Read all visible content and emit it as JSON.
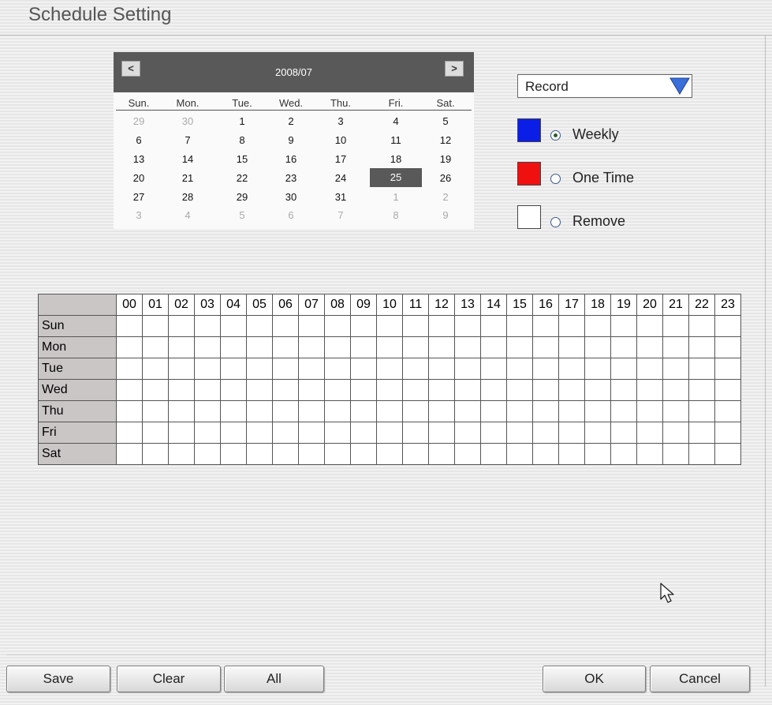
{
  "window": {
    "title": "Schedule Setting"
  },
  "calendar": {
    "month_label": "2008/07",
    "prev_label": "<",
    "next_label": ">",
    "weekdays": [
      "Sun.",
      "Mon.",
      "Tue.",
      "Wed.",
      "Thu.",
      "Fri.",
      "Sat."
    ],
    "weeks": [
      [
        {
          "d": "29",
          "other": true
        },
        {
          "d": "30",
          "other": true
        },
        {
          "d": "1"
        },
        {
          "d": "2"
        },
        {
          "d": "3"
        },
        {
          "d": "4"
        },
        {
          "d": "5"
        }
      ],
      [
        {
          "d": "6"
        },
        {
          "d": "7"
        },
        {
          "d": "8"
        },
        {
          "d": "9"
        },
        {
          "d": "10"
        },
        {
          "d": "11"
        },
        {
          "d": "12"
        }
      ],
      [
        {
          "d": "13"
        },
        {
          "d": "14"
        },
        {
          "d": "15"
        },
        {
          "d": "16"
        },
        {
          "d": "17"
        },
        {
          "d": "18"
        },
        {
          "d": "19"
        }
      ],
      [
        {
          "d": "20"
        },
        {
          "d": "21"
        },
        {
          "d": "22"
        },
        {
          "d": "23"
        },
        {
          "d": "24"
        },
        {
          "d": "25",
          "selected": true
        },
        {
          "d": "26"
        }
      ],
      [
        {
          "d": "27"
        },
        {
          "d": "28"
        },
        {
          "d": "29"
        },
        {
          "d": "30"
        },
        {
          "d": "31"
        },
        {
          "d": "1",
          "other": true
        },
        {
          "d": "2",
          "other": true
        }
      ],
      [
        {
          "d": "3",
          "other": true
        },
        {
          "d": "4",
          "other": true
        },
        {
          "d": "5",
          "other": true
        },
        {
          "d": "6",
          "other": true
        },
        {
          "d": "7",
          "other": true
        },
        {
          "d": "8",
          "other": true
        },
        {
          "d": "9",
          "other": true
        }
      ]
    ]
  },
  "mode_select": {
    "value": "Record",
    "arrow_color": "#3b6fd8"
  },
  "options": [
    {
      "label": "Weekly",
      "color": "#0a1ee8",
      "checked": true
    },
    {
      "label": "One Time",
      "color": "#f01010",
      "checked": false
    },
    {
      "label": "Remove",
      "color": "#ffffff",
      "checked": false
    }
  ],
  "grid": {
    "hours": [
      "00",
      "01",
      "02",
      "03",
      "04",
      "05",
      "06",
      "07",
      "08",
      "09",
      "10",
      "11",
      "12",
      "13",
      "14",
      "15",
      "16",
      "17",
      "18",
      "19",
      "20",
      "21",
      "22",
      "23"
    ],
    "days": [
      "Sun",
      "Mon",
      "Tue",
      "Wed",
      "Thu",
      "Fri",
      "Sat"
    ]
  },
  "buttons": {
    "save": "Save",
    "clear": "Clear",
    "all": "All",
    "ok": "OK",
    "cancel": "Cancel"
  },
  "icons": {
    "cursor": "mouse-pointer-icon",
    "dropdown": "triangle-down-icon"
  }
}
